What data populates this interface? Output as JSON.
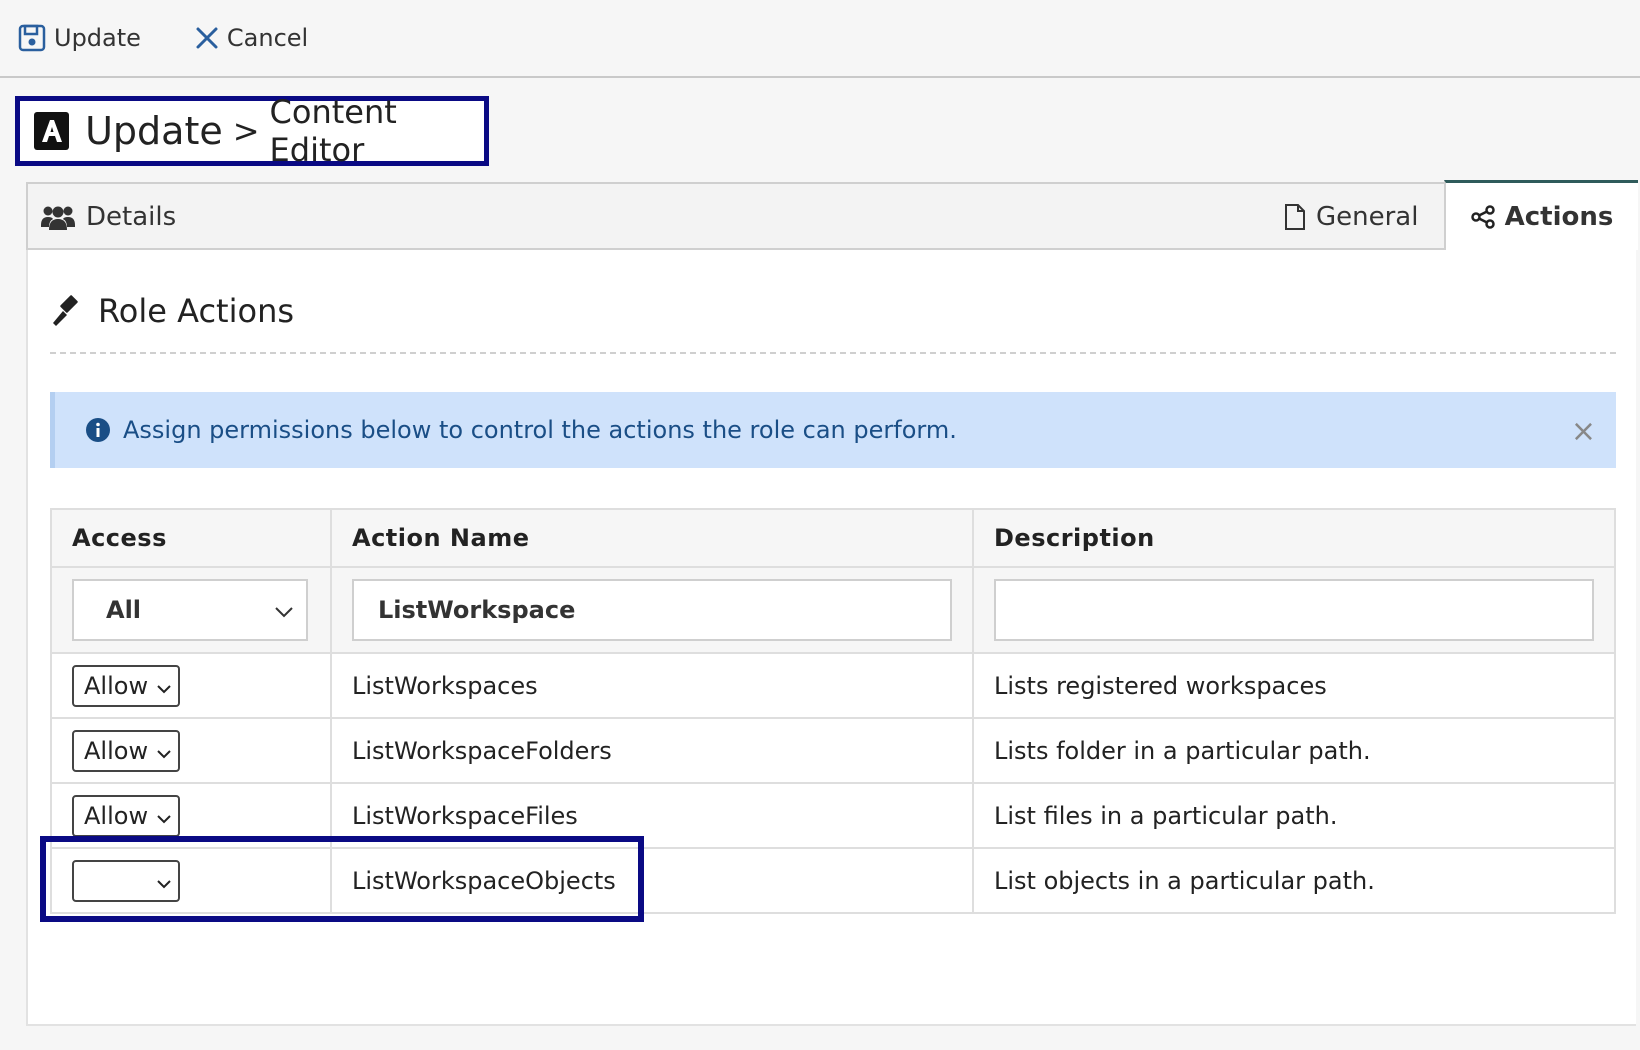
{
  "toolbar": {
    "update_label": "Update",
    "cancel_label": "Cancel"
  },
  "title": {
    "main": "Update",
    "separator": ">",
    "sub": "Content Editor",
    "logo_letter": "A"
  },
  "tabs": {
    "details": "Details",
    "general": "General",
    "actions": "Actions"
  },
  "section": {
    "title": "Role Actions"
  },
  "alert": {
    "message": "Assign permissions below to control the actions the role can perform.",
    "close": "×"
  },
  "table": {
    "headers": {
      "access": "Access",
      "name": "Action Name",
      "description": "Description"
    },
    "filter": {
      "access": "All",
      "name": "ListWorkspace",
      "description": ""
    },
    "rows": [
      {
        "access": "Allow",
        "name": "ListWorkspaces",
        "description": "Lists registered workspaces"
      },
      {
        "access": "Allow",
        "name": "ListWorkspaceFolders",
        "description": "Lists folder in a particular path."
      },
      {
        "access": "Allow",
        "name": "ListWorkspaceFiles",
        "description": "List files in a particular path."
      },
      {
        "access": "",
        "name": "ListWorkspaceObjects",
        "description": "List objects in a particular path."
      }
    ]
  },
  "colors": {
    "highlight": "#0a0a84",
    "accent_tab": "#2f5b5b",
    "alert_bg": "#cfe2fb",
    "alert_text": "#1a4e86",
    "toolbar_icon": "#2a5f9e"
  }
}
